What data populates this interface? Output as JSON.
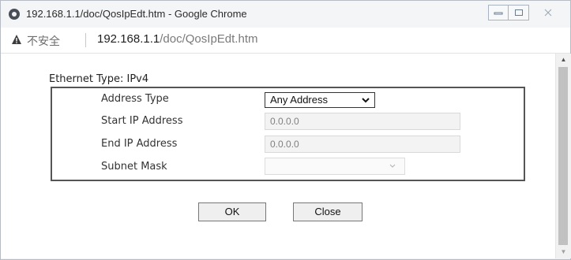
{
  "window": {
    "title": "192.168.1.1/doc/QosIpEdt.htm - Google Chrome",
    "controls": {
      "minimize": "▭",
      "maximize": "▢",
      "close": "✕"
    }
  },
  "addressbar": {
    "security_label": "不安全",
    "url_host": "192.168.1.1",
    "url_path": "/doc/QosIpEdt.htm"
  },
  "form": {
    "legend": "Ethernet Type: IPv4",
    "address_type": {
      "label": "Address Type",
      "value": "Any Address"
    },
    "start_ip": {
      "label": "Start IP Address",
      "value": "0.0.0.0"
    },
    "end_ip": {
      "label": "End IP Address",
      "value": "0.0.0.0"
    },
    "subnet_mask": {
      "label": "Subnet Mask",
      "value": ""
    }
  },
  "buttons": {
    "ok": "OK",
    "close": "Close"
  },
  "icons": {
    "app": "chrome-icon",
    "warning": "warning-triangle-icon",
    "dropdown": "chevron-down-icon"
  }
}
